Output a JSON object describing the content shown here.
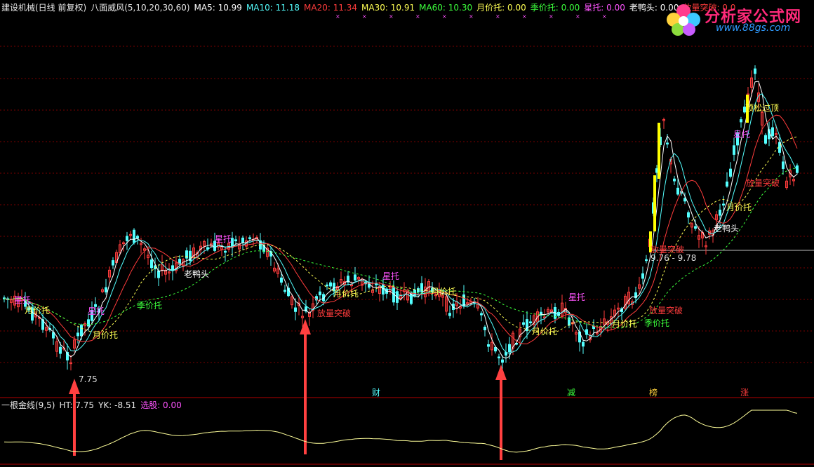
{
  "header": {
    "title": "建设机械(日线 前复权)",
    "indicator": "八面威风(5,10,20,30,60)",
    "ma5": "MA5: 10.99",
    "ma10": "MA10: 11.18",
    "ma20": "MA20: 11.34",
    "ma30": "MA30: 10.91",
    "ma60": "MA60: 10.30",
    "yuejiatuo": "月价托: 0.00",
    "jijiatuo": "季价托: 0.00",
    "xingtuo": "星托: 0.00",
    "laoyatou": "老鸭头: 0.00",
    "fangliang": "放量突破: 0.0"
  },
  "colors": {
    "up": "#ff3c3c",
    "down": "#54ffff",
    "ma5": "#ffffff",
    "ma10": "#54ffff",
    "ma20": "#ff3c3c",
    "ma30": "#ffff54",
    "ma60": "#3cff3c",
    "grid": "#7a0000",
    "xingtuo": "#ff54ff",
    "yuejiatuo": "#ffff54",
    "jijiatuo": "#3cff3c",
    "fangliang": "#ff3c3c",
    "laoyatou": "#ffffff"
  },
  "logo": {
    "brand": "分析家公式网",
    "url": "www.88gs.com"
  },
  "annotations": {
    "low_label": "7.75",
    "range_label": "9.76 - 9.78",
    "xingtuo": "星托",
    "yuejiatuo": "月价托",
    "jijiatuo": "季价托",
    "laoyatou": "老鸭头",
    "fangliang": "放量突破",
    "dingsong": "顶松过顶"
  },
  "events": [
    "财",
    "减",
    "榜",
    "涨"
  ],
  "sub_header": {
    "name": "一根金线(9,5)",
    "ht": "HT: 7.75",
    "yk": "YK: -8.51",
    "xuangu": "选股: 0.00"
  }
}
